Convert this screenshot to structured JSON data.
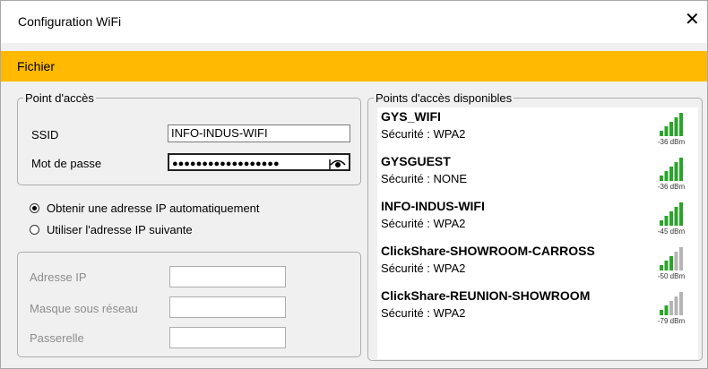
{
  "window": {
    "title": "Configuration WiFi",
    "close_glyph": "✕"
  },
  "menu": {
    "items": [
      {
        "label": "Fichier"
      }
    ]
  },
  "point_acces": {
    "legend": "Point d'accès",
    "ssid_label": "SSID",
    "ssid_value": "INFO-INDUS-WIFI",
    "password_label": "Mot de passe",
    "password_mask": "●●●●●●●●●●●●●●●●●●",
    "eye_icon": "eye-icon"
  },
  "ip_mode": {
    "auto_label": "Obtenir une adresse IP automatiquement",
    "manual_label": "Utiliser l'adresse IP suivante",
    "selected": "auto"
  },
  "ip_fields": {
    "address_label": "Adresse IP",
    "mask_label": "Masque  sous réseau",
    "gateway_label": "Passerelle"
  },
  "available": {
    "legend": "Points d'accès disponibles",
    "networks": [
      {
        "name": "GYS_WIFI",
        "security": "Sécurité : WPA2",
        "dbm": "-36 dBm",
        "bars": 5
      },
      {
        "name": "GYSGUEST",
        "security": "Sécurité : NONE",
        "dbm": "-36 dBm",
        "bars": 5
      },
      {
        "name": "INFO-INDUS-WIFI",
        "security": "Sécurité : WPA2",
        "dbm": "-45 dBm",
        "bars": 5
      },
      {
        "name": "ClickShare-SHOWROOM-CARROSS",
        "security": "Sécurité : WPA2",
        "dbm": "-50 dBm",
        "bars": 3
      },
      {
        "name": "ClickShare-REUNION-SHOWROOM",
        "security": "Sécurité : WPA2",
        "dbm": "-79 dBm",
        "bars": 2
      }
    ]
  },
  "colors": {
    "menubar": "#ffb900",
    "signal_on": "#2aa52a",
    "signal_off": "#b5b5b5"
  }
}
